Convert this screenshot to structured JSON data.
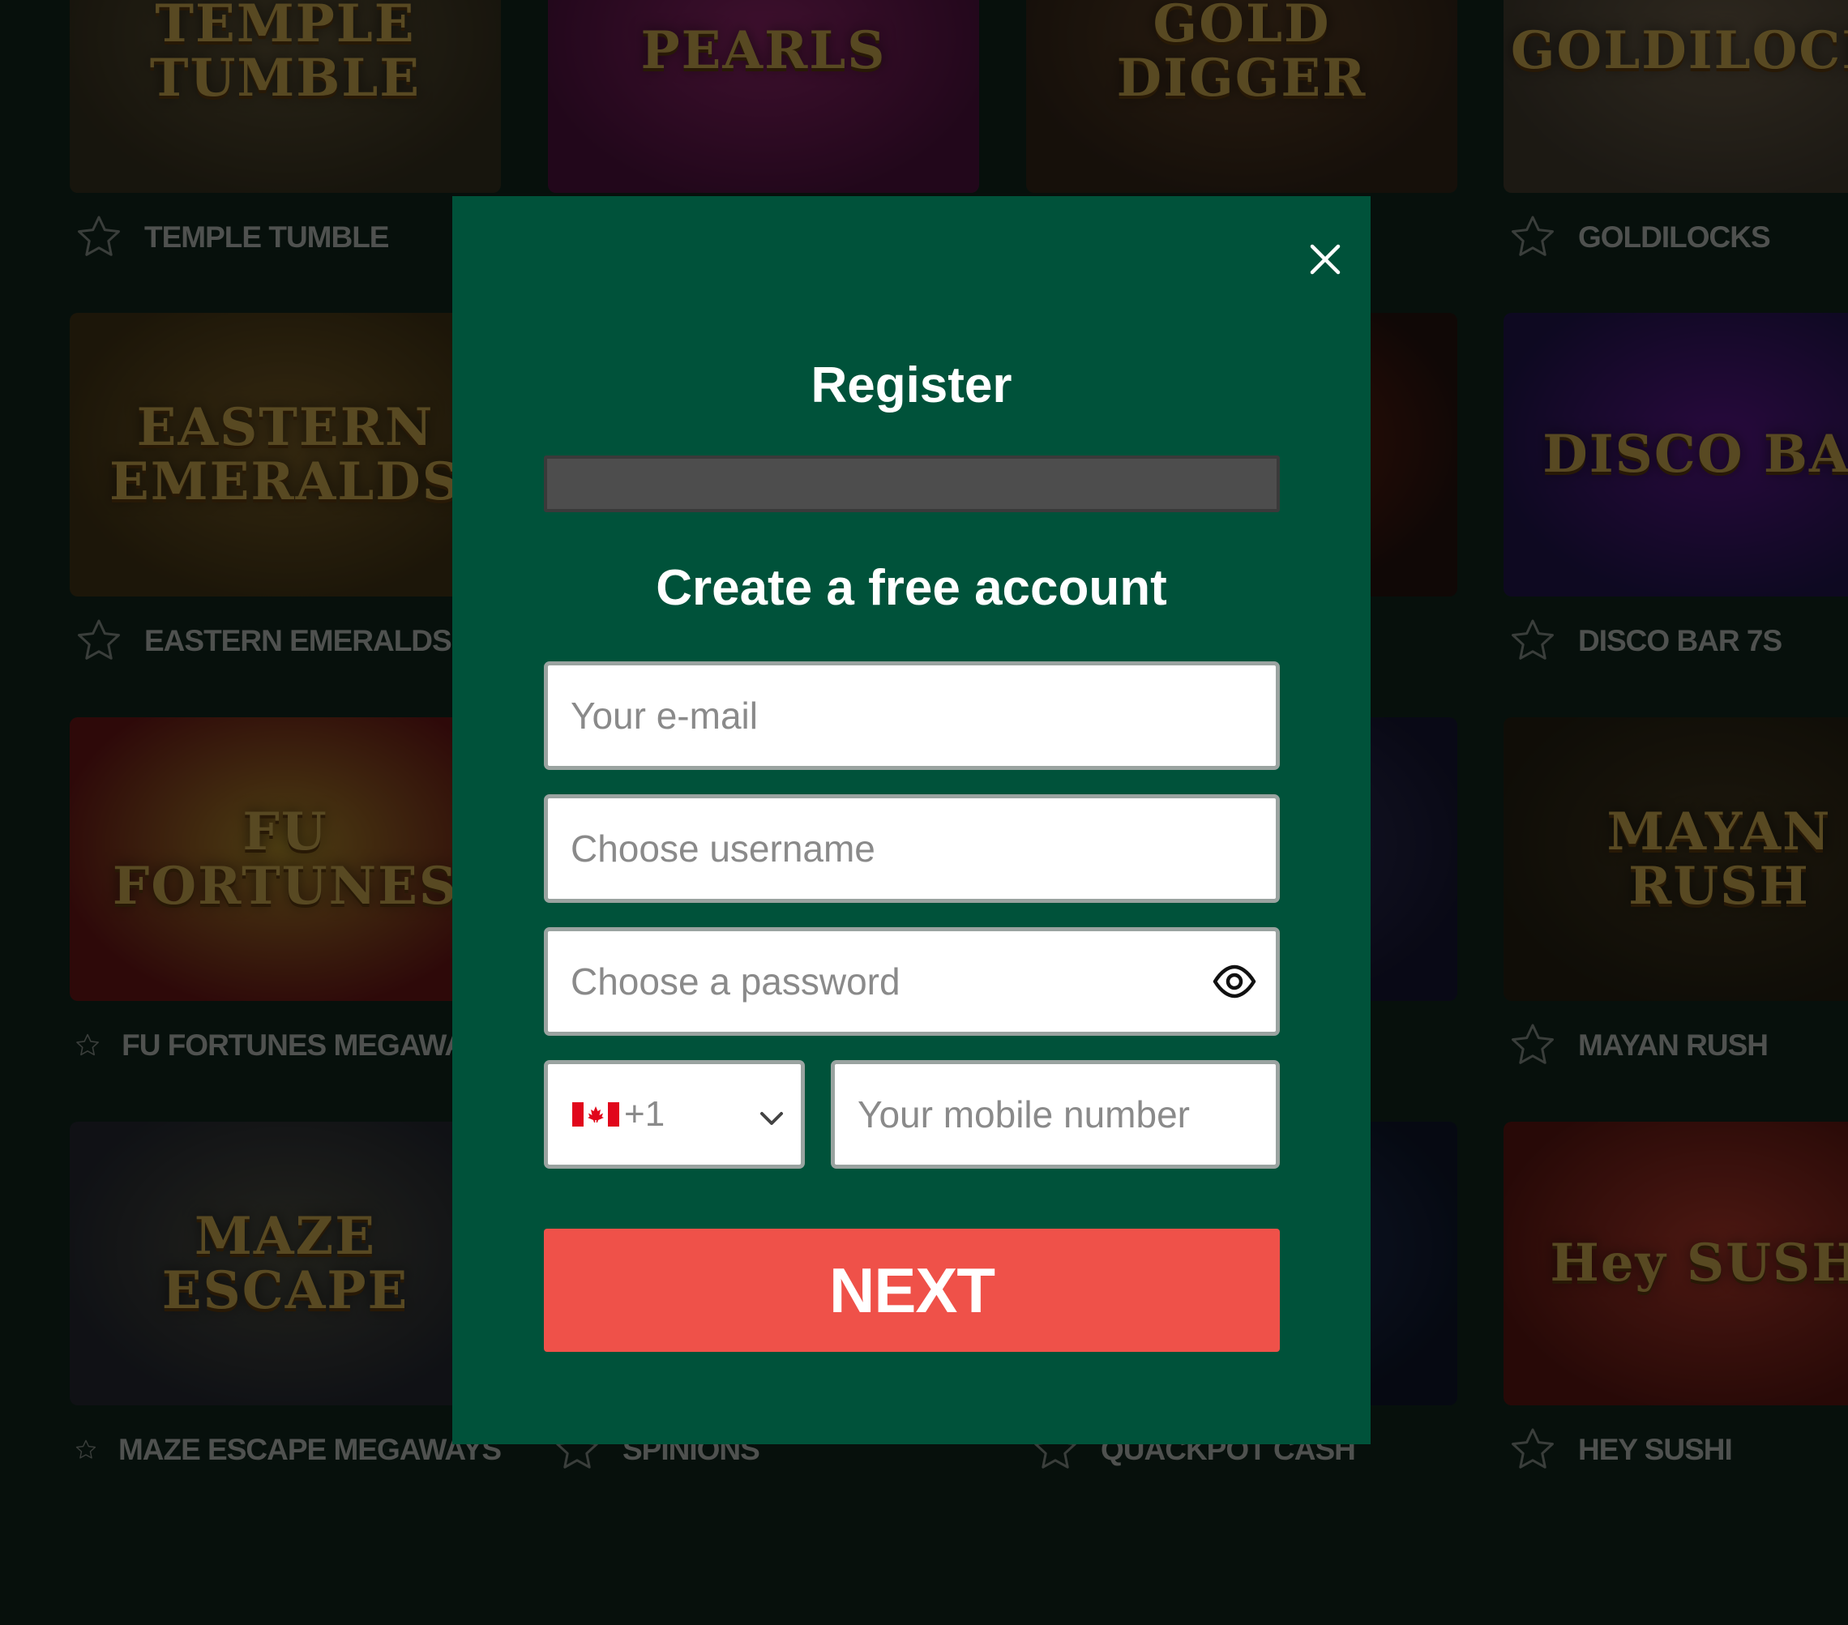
{
  "games": [
    {
      "name": "TEMPLE TUMBLE",
      "logo": "TEMPLE TUMBLE"
    },
    {
      "name": "",
      "logo": "PEARLS"
    },
    {
      "name": "",
      "logo": "GOLD DIGGER"
    },
    {
      "name": "GOLDILOCKS",
      "logo": "GOLDILOCKS"
    },
    {
      "name": "EASTERN EMERALDS",
      "logo": "EASTERN EMERALDS"
    },
    {
      "name": "",
      "logo": ""
    },
    {
      "name": "",
      "logo": ""
    },
    {
      "name": "DISCO BAR 7S",
      "logo": "DISCO BAR"
    },
    {
      "name": "FU FORTUNES MEGAWAYS",
      "logo": "FU FORTUNES"
    },
    {
      "name": "",
      "logo": ""
    },
    {
      "name": "",
      "logo": ""
    },
    {
      "name": "MAYAN RUSH",
      "logo": "MAYAN RUSH"
    },
    {
      "name": "MAZE ESCAPE MEGAWAYS",
      "logo": "MAZE ESCAPE"
    },
    {
      "name": "SPINIONS",
      "logo": ""
    },
    {
      "name": "QUACKPOT CASH",
      "logo": ""
    },
    {
      "name": "HEY SUSHI",
      "logo": "Hey SUSHI"
    }
  ],
  "modal": {
    "title": "Register",
    "subtitle": "Create a free account",
    "email_placeholder": "Your e-mail",
    "username_placeholder": "Choose username",
    "password_placeholder": "Choose a password",
    "phone_code": "+1",
    "mobile_placeholder": "Your mobile number",
    "next_label": "NEXT"
  },
  "colors": {
    "page_bg": "#132a20",
    "modal_bg": "#00523a",
    "next_button": "#ef5149",
    "progress_bar": "#4d4d4d"
  },
  "icons": {
    "close": "close-icon",
    "eye": "eye-icon",
    "flag": "canada-flag-icon",
    "chevron": "chevron-down-icon",
    "favorite": "star-icon"
  }
}
